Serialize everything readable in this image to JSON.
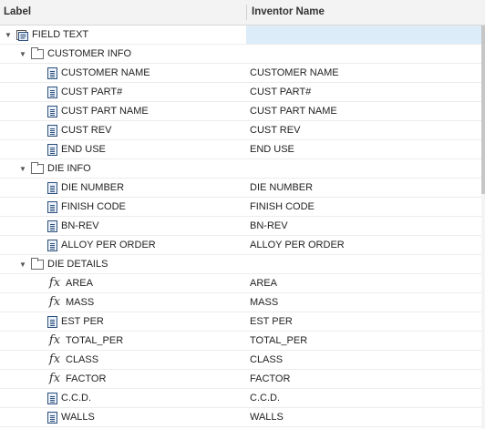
{
  "header": {
    "label_col": "Label",
    "inventor_col": "Inventor Name"
  },
  "rows": [
    {
      "level": 0,
      "kind": "root",
      "icon": "field-text-icon",
      "expander": "expanded",
      "label": "FIELD TEXT",
      "value": ""
    },
    {
      "level": 1,
      "kind": "folder",
      "icon": "folder-icon",
      "expander": "expanded",
      "label": "CUSTOMER INFO",
      "value": ""
    },
    {
      "level": 2,
      "kind": "prop",
      "icon": "property-icon",
      "expander": "none",
      "label": "CUSTOMER NAME",
      "value": "CUSTOMER NAME"
    },
    {
      "level": 2,
      "kind": "prop",
      "icon": "property-icon",
      "expander": "none",
      "label": "CUST PART#",
      "value": "CUST PART#"
    },
    {
      "level": 2,
      "kind": "prop",
      "icon": "property-icon",
      "expander": "none",
      "label": "CUST PART NAME",
      "value": "CUST PART NAME"
    },
    {
      "level": 2,
      "kind": "prop",
      "icon": "property-icon",
      "expander": "none",
      "label": "CUST REV",
      "value": "CUST REV"
    },
    {
      "level": 2,
      "kind": "prop",
      "icon": "property-icon",
      "expander": "none",
      "label": "END USE",
      "value": "END USE"
    },
    {
      "level": 1,
      "kind": "folder",
      "icon": "folder-icon",
      "expander": "expanded",
      "label": "DIE INFO",
      "value": ""
    },
    {
      "level": 2,
      "kind": "prop",
      "icon": "property-icon",
      "expander": "none",
      "label": "DIE NUMBER",
      "value": "DIE NUMBER"
    },
    {
      "level": 2,
      "kind": "prop",
      "icon": "property-icon",
      "expander": "none",
      "label": "FINISH CODE",
      "value": "FINISH CODE"
    },
    {
      "level": 2,
      "kind": "prop",
      "icon": "property-icon",
      "expander": "none",
      "label": "BN-REV",
      "value": "BN-REV"
    },
    {
      "level": 2,
      "kind": "prop",
      "icon": "property-icon",
      "expander": "none",
      "label": "ALLOY PER ORDER",
      "value": "ALLOY PER ORDER"
    },
    {
      "level": 1,
      "kind": "folder",
      "icon": "folder-icon",
      "expander": "expanded",
      "label": "DIE DETAILS",
      "value": ""
    },
    {
      "level": 2,
      "kind": "fx",
      "icon": "fx-icon",
      "expander": "none",
      "label": "AREA",
      "value": "AREA"
    },
    {
      "level": 2,
      "kind": "fx",
      "icon": "fx-icon",
      "expander": "none",
      "label": "MASS",
      "value": "MASS"
    },
    {
      "level": 2,
      "kind": "prop",
      "icon": "property-icon",
      "expander": "none",
      "label": "EST PER",
      "value": "EST PER"
    },
    {
      "level": 2,
      "kind": "fx",
      "icon": "fx-icon",
      "expander": "none",
      "label": "TOTAL_PER",
      "value": "TOTAL_PER"
    },
    {
      "level": 2,
      "kind": "fx",
      "icon": "fx-icon",
      "expander": "none",
      "label": "CLASS",
      "value": "CLASS"
    },
    {
      "level": 2,
      "kind": "fx",
      "icon": "fx-icon",
      "expander": "none",
      "label": "FACTOR",
      "value": "FACTOR"
    },
    {
      "level": 2,
      "kind": "prop",
      "icon": "property-icon",
      "expander": "none",
      "label": "C.C.D.",
      "value": "C.C.D."
    },
    {
      "level": 2,
      "kind": "prop",
      "icon": "property-icon",
      "expander": "none",
      "label": "WALLS",
      "value": "WALLS"
    }
  ],
  "colors": {
    "selection": "#dcecf8",
    "header_bg": "#f3f3f3",
    "row_divider": "#ececec"
  },
  "fx_glyph": "fx"
}
